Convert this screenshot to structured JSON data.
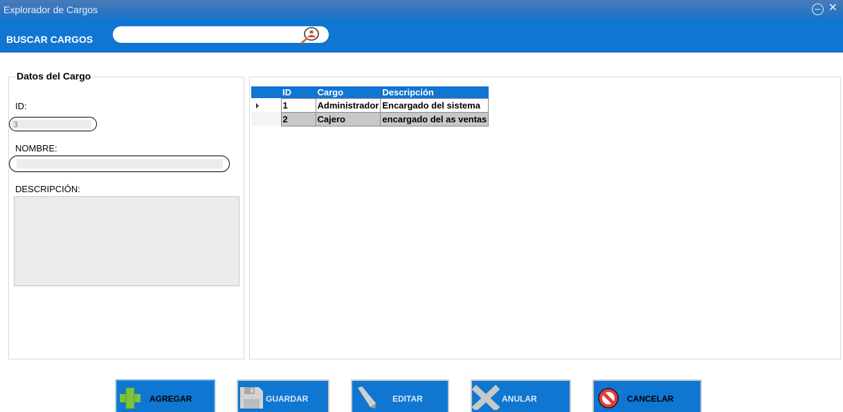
{
  "window": {
    "title": "Explorador de Cargos",
    "accent_color": "#0f76d2",
    "controls": {
      "minimize_icon": "circle-minus-icon",
      "close_icon": "close-icon",
      "close_glyph": "✕"
    }
  },
  "search": {
    "label": "BUSCAR CARGOS",
    "value": "",
    "placeholder": "",
    "icon": "user-search-icon"
  },
  "form": {
    "legend": "Datos del Cargo",
    "id_label": "ID:",
    "id_value": "3",
    "nombre_label": "NOMBRE:",
    "nombre_value": "",
    "descripcion_label": "DESCRIPCIÓN:",
    "descripcion_value": ""
  },
  "grid": {
    "columns": [
      "ID",
      "Cargo",
      "Descripción"
    ],
    "rows": [
      {
        "id": "1",
        "cargo": "Administrador",
        "descripcion": "Encargado del sistema",
        "current": true
      },
      {
        "id": "2",
        "cargo": "Cajero",
        "descripcion": "encargado del as ventas",
        "current": false
      }
    ]
  },
  "buttons": {
    "agregar": {
      "label": "AGREGAR",
      "icon": "plus-icon",
      "active": true
    },
    "guardar": {
      "label": "GUARDAR",
      "icon": "floppy-disk-icon",
      "active": false
    },
    "editar": {
      "label": "EDITAR",
      "icon": "pencil-icon",
      "active": false
    },
    "anular": {
      "label": "ANULAR",
      "icon": "x-cross-icon",
      "active": false
    },
    "cancelar": {
      "label": "CANCELAR",
      "icon": "prohibited-icon",
      "active": false
    }
  }
}
